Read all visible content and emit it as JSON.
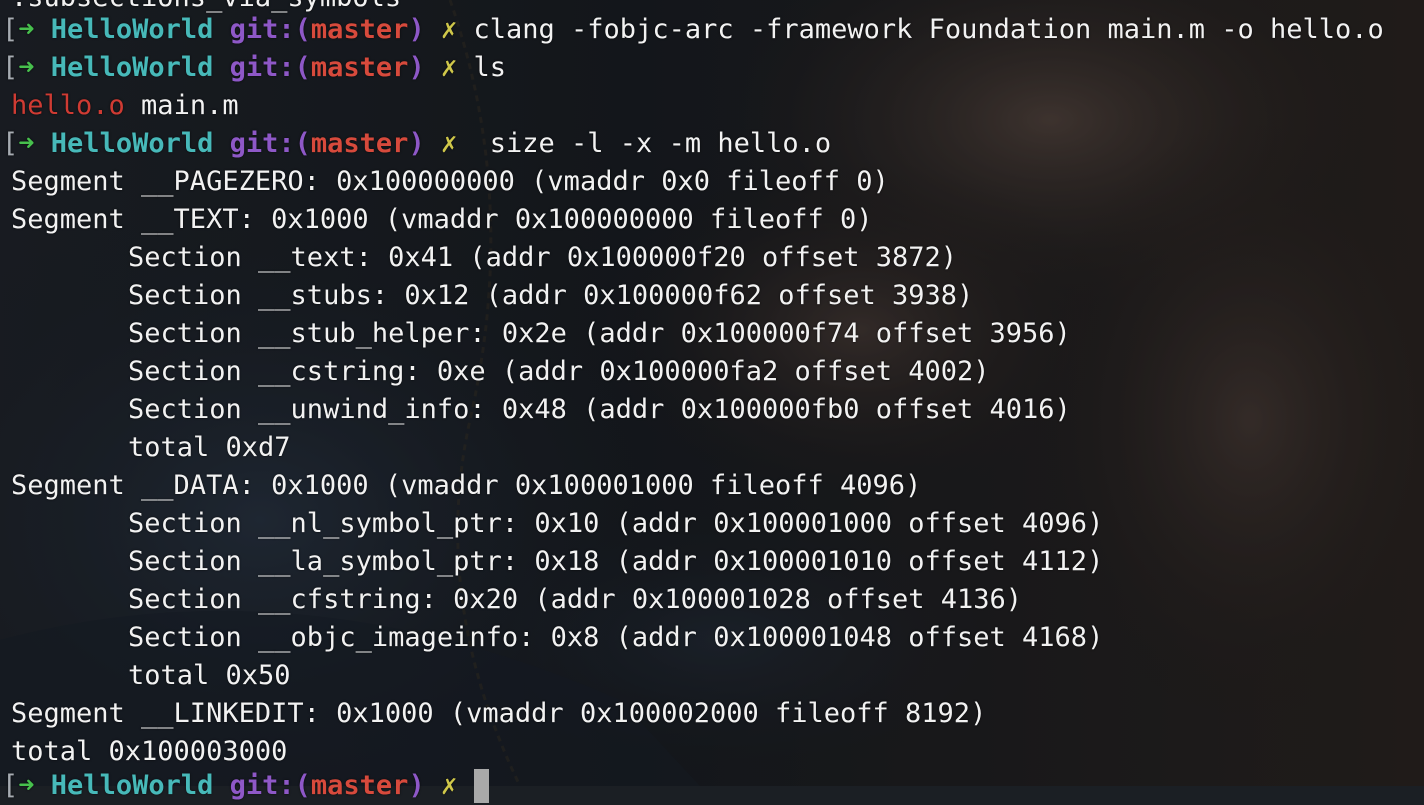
{
  "terminal": {
    "partial_top_line": ".subsections_via_symbols",
    "prompt": {
      "bracket": "[",
      "arrow": "➜",
      "directory": "HelloWorld",
      "git_prefix": "git:(",
      "branch": "master",
      "git_suffix": ")",
      "dirty_mark": "✗"
    },
    "commands": [
      " clang -fobjc-arc -framework Foundation main.m -o hello.o",
      " ls",
      "  size -l -x -m hello.o"
    ],
    "ls_output": {
      "file1": "hello.o",
      "file2": " main.m"
    },
    "size_output": [
      "Segment __PAGEZERO: 0x100000000 (vmaddr 0x0 fileoff 0)",
      "Segment __TEXT: 0x1000 (vmaddr 0x100000000 fileoff 0)",
      "Section __text: 0x41 (addr 0x100000f20 offset 3872)",
      "Section __stubs: 0x12 (addr 0x100000f62 offset 3938)",
      "Section __stub_helper: 0x2e (addr 0x100000f74 offset 3956)",
      "Section __cstring: 0xe (addr 0x100000fa2 offset 4002)",
      "Section __unwind_info: 0x48 (addr 0x100000fb0 offset 4016)",
      "total 0xd7",
      "Segment __DATA: 0x1000 (vmaddr 0x100001000 fileoff 4096)",
      "Section __nl_symbol_ptr: 0x10 (addr 0x100001000 offset 4096)",
      "Section __la_symbol_ptr: 0x18 (addr 0x100001010 offset 4112)",
      "Section __cfstring: 0x20 (addr 0x100001028 offset 4136)",
      "Section __objc_imageinfo: 0x8 (addr 0x100001048 offset 4168)",
      "total 0x50",
      "Segment __LINKEDIT: 0x1000 (vmaddr 0x100002000 fileoff 8192)",
      "total 0x100003000"
    ]
  },
  "colors": {
    "prompt_arrow": "#47c04d",
    "directory": "#47b9b9",
    "git_label": "#8e58c7",
    "branch": "#d74a3c",
    "dirty_mark": "#cfc74a",
    "ls_file_highlight": "#cf3b33",
    "foreground": "#f2f2f2"
  }
}
